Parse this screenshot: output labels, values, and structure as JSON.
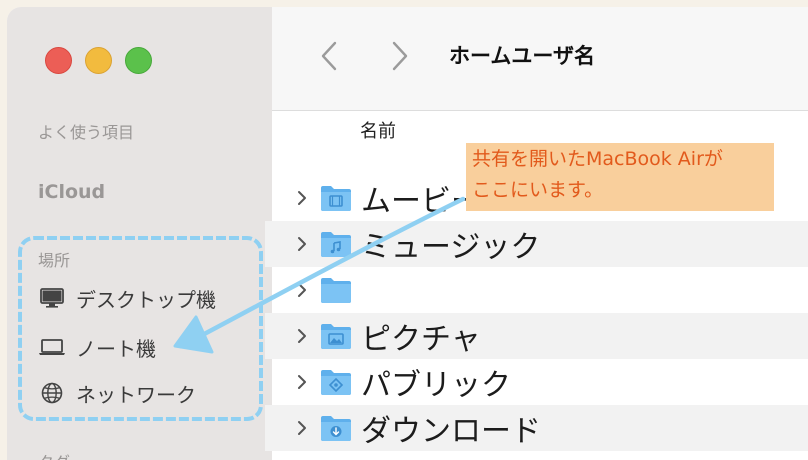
{
  "window": {
    "title": "ホームユーザ名"
  },
  "sidebar": {
    "favorites_heading": "よく使う項目",
    "icloud_heading": "iCloud",
    "locations_heading": "場所",
    "items": [
      {
        "label": "デスクトップ機",
        "icon": "desktop-icon"
      },
      {
        "label": "ノート機",
        "icon": "laptop-icon"
      },
      {
        "label": "ネットワーク",
        "icon": "globe-icon"
      }
    ],
    "tags_heading_partial": "タグ"
  },
  "list": {
    "column_name": "名前",
    "rows": [
      {
        "label": "ムービー",
        "icon": "movies-folder-icon"
      },
      {
        "label": "ミュージック",
        "icon": "music-folder-icon"
      },
      {
        "label": "",
        "icon": "folder-icon"
      },
      {
        "label": "ピクチャ",
        "icon": "pictures-folder-icon"
      },
      {
        "label": "パブリック",
        "icon": "public-folder-icon"
      },
      {
        "label": "ダウンロード",
        "icon": "downloads-folder-icon"
      }
    ]
  },
  "annotation": {
    "line1": "共有を開いたMacBook Airが",
    "line2": "ここにいます。",
    "colors": {
      "callout_bg": "#f9cf9c",
      "callout_text": "#e25a1c",
      "highlight": "#8fd0f2"
    }
  }
}
